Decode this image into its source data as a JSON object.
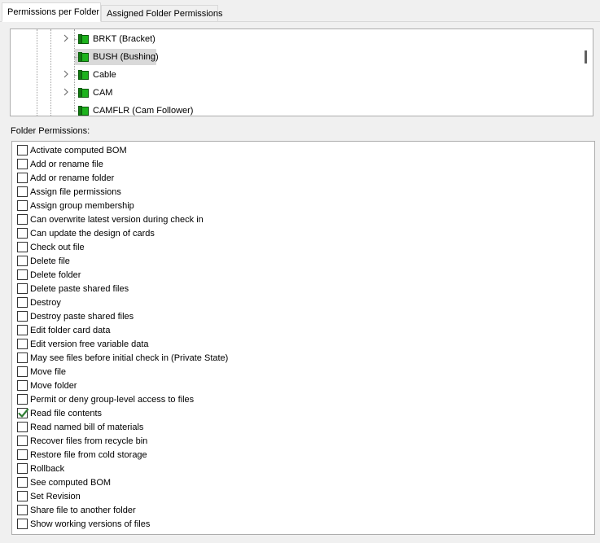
{
  "tabs": [
    {
      "label": "Permissions per Folder",
      "active": true
    },
    {
      "label": "Assigned Folder Permissions",
      "active": false
    }
  ],
  "folder_tree": {
    "nodes": [
      {
        "label": "BRKT (Bracket)",
        "expandable": true,
        "selected": false
      },
      {
        "label": "BUSH (Bushing)",
        "expandable": false,
        "selected": true
      },
      {
        "label": "Cable",
        "expandable": true,
        "selected": false
      },
      {
        "label": "CAM",
        "expandable": true,
        "selected": false
      },
      {
        "label": "CAMFLR (Cam Follower)",
        "expandable": false,
        "selected": false
      }
    ],
    "folder_icon": "green-folder-icon",
    "folder_color": "#1db31d"
  },
  "folder_permissions": {
    "label": "Folder Permissions:",
    "items": [
      {
        "label": "Activate computed BOM",
        "checked": false
      },
      {
        "label": "Add or rename file",
        "checked": false
      },
      {
        "label": "Add or rename folder",
        "checked": false
      },
      {
        "label": "Assign file permissions",
        "checked": false
      },
      {
        "label": "Assign group membership",
        "checked": false
      },
      {
        "label": "Can overwrite latest version during check in",
        "checked": false
      },
      {
        "label": "Can update the design of cards",
        "checked": false
      },
      {
        "label": "Check out file",
        "checked": false
      },
      {
        "label": "Delete file",
        "checked": false
      },
      {
        "label": "Delete folder",
        "checked": false
      },
      {
        "label": "Delete paste shared files",
        "checked": false
      },
      {
        "label": "Destroy",
        "checked": false
      },
      {
        "label": "Destroy paste shared files",
        "checked": false
      },
      {
        "label": "Edit folder card data",
        "checked": false
      },
      {
        "label": "Edit version free variable data",
        "checked": false
      },
      {
        "label": "May see files before initial check in (Private State)",
        "checked": false
      },
      {
        "label": "Move file",
        "checked": false
      },
      {
        "label": "Move folder",
        "checked": false
      },
      {
        "label": "Permit or deny group-level access to files",
        "checked": false
      },
      {
        "label": "Read file contents",
        "checked": true
      },
      {
        "label": "Read named bill of materials",
        "checked": false
      },
      {
        "label": "Recover files from recycle bin",
        "checked": false
      },
      {
        "label": "Restore file from cold storage",
        "checked": false
      },
      {
        "label": "Rollback",
        "checked": false
      },
      {
        "label": "See computed BOM",
        "checked": false
      },
      {
        "label": "Set Revision",
        "checked": false
      },
      {
        "label": "Share file to another folder",
        "checked": false
      },
      {
        "label": "Show working versions of files",
        "checked": false
      }
    ],
    "check_color": "#2e7d32"
  }
}
